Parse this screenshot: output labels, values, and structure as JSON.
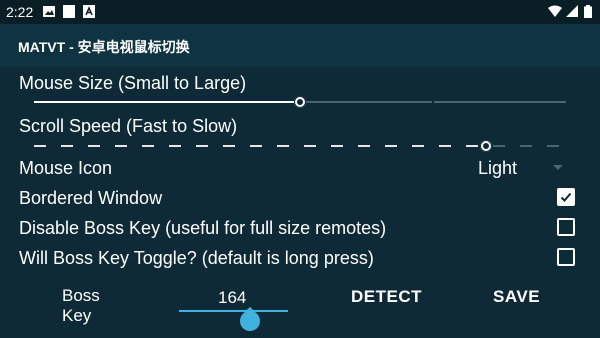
{
  "status_bar": {
    "time": "2:22"
  },
  "app_bar": {
    "title": "MATVT - 安卓电视鼠标切换"
  },
  "settings": {
    "mouse_size": {
      "label": "Mouse Size (Small to Large)",
      "value_fraction": 0.5
    },
    "scroll_speed": {
      "label": "Scroll Speed (Fast to Slow)",
      "value_fraction": 0.85
    },
    "mouse_icon": {
      "label": "Mouse Icon",
      "value": "Light"
    },
    "bordered_window": {
      "label": "Bordered Window",
      "checked": true
    },
    "disable_boss_key": {
      "label": "Disable Boss Key (useful for full size remotes)",
      "checked": false
    },
    "boss_key_toggle": {
      "label": "Will Boss Key Toggle? (default is long press)",
      "checked": false
    }
  },
  "boss_key": {
    "label": "Boss Key",
    "keycode": "164",
    "detect_label": "DETECT",
    "save_label": "SAVE"
  },
  "colors": {
    "background": "#0e2a36",
    "app_bar": "#0f3441",
    "accent": "#3fb3e0"
  }
}
